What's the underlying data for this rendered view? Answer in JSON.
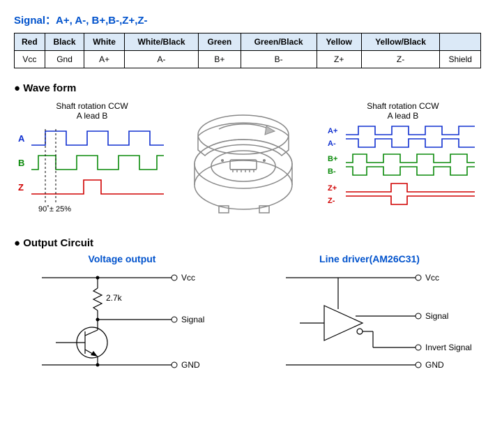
{
  "signal_header": "Signal：A+, A-, B+,B-,Z+,Z-",
  "wire_colors": [
    "Red",
    "Black",
    "White",
    "White/Black",
    "Green",
    "Green/Black",
    "Yellow",
    "Yellow/Black",
    ""
  ],
  "wire_signals": [
    "Vcc",
    "Gnd",
    "A+",
    "A-",
    "B+",
    "B-",
    "Z+",
    "Z-",
    "Shield"
  ],
  "section_waveform": "Wave form",
  "wave_left": {
    "caption1": "Shaft rotation CCW",
    "caption2": "A lead B",
    "labels": {
      "A": "A",
      "B": "B",
      "Z": "Z"
    },
    "phase_note": "90˚± 25%"
  },
  "wave_right": {
    "caption1": "Shaft rotation CCW",
    "caption2": "A lead B",
    "labels": {
      "Ap": "A+",
      "Am": "A-",
      "Bp": "B+",
      "Bm": "B-",
      "Zp": "Z+",
      "Zm": "Z-"
    }
  },
  "section_output": "Output Circuit",
  "voltage_out": {
    "title": "Voltage output",
    "vcc": "Vcc",
    "r": "2.7k",
    "signal": "Signal",
    "gnd": "GND"
  },
  "line_driver": {
    "title": "Line driver(AM26C31)",
    "vcc": "Vcc",
    "signal": "Signal",
    "inv": "Invert Signal",
    "gnd": "GND"
  }
}
